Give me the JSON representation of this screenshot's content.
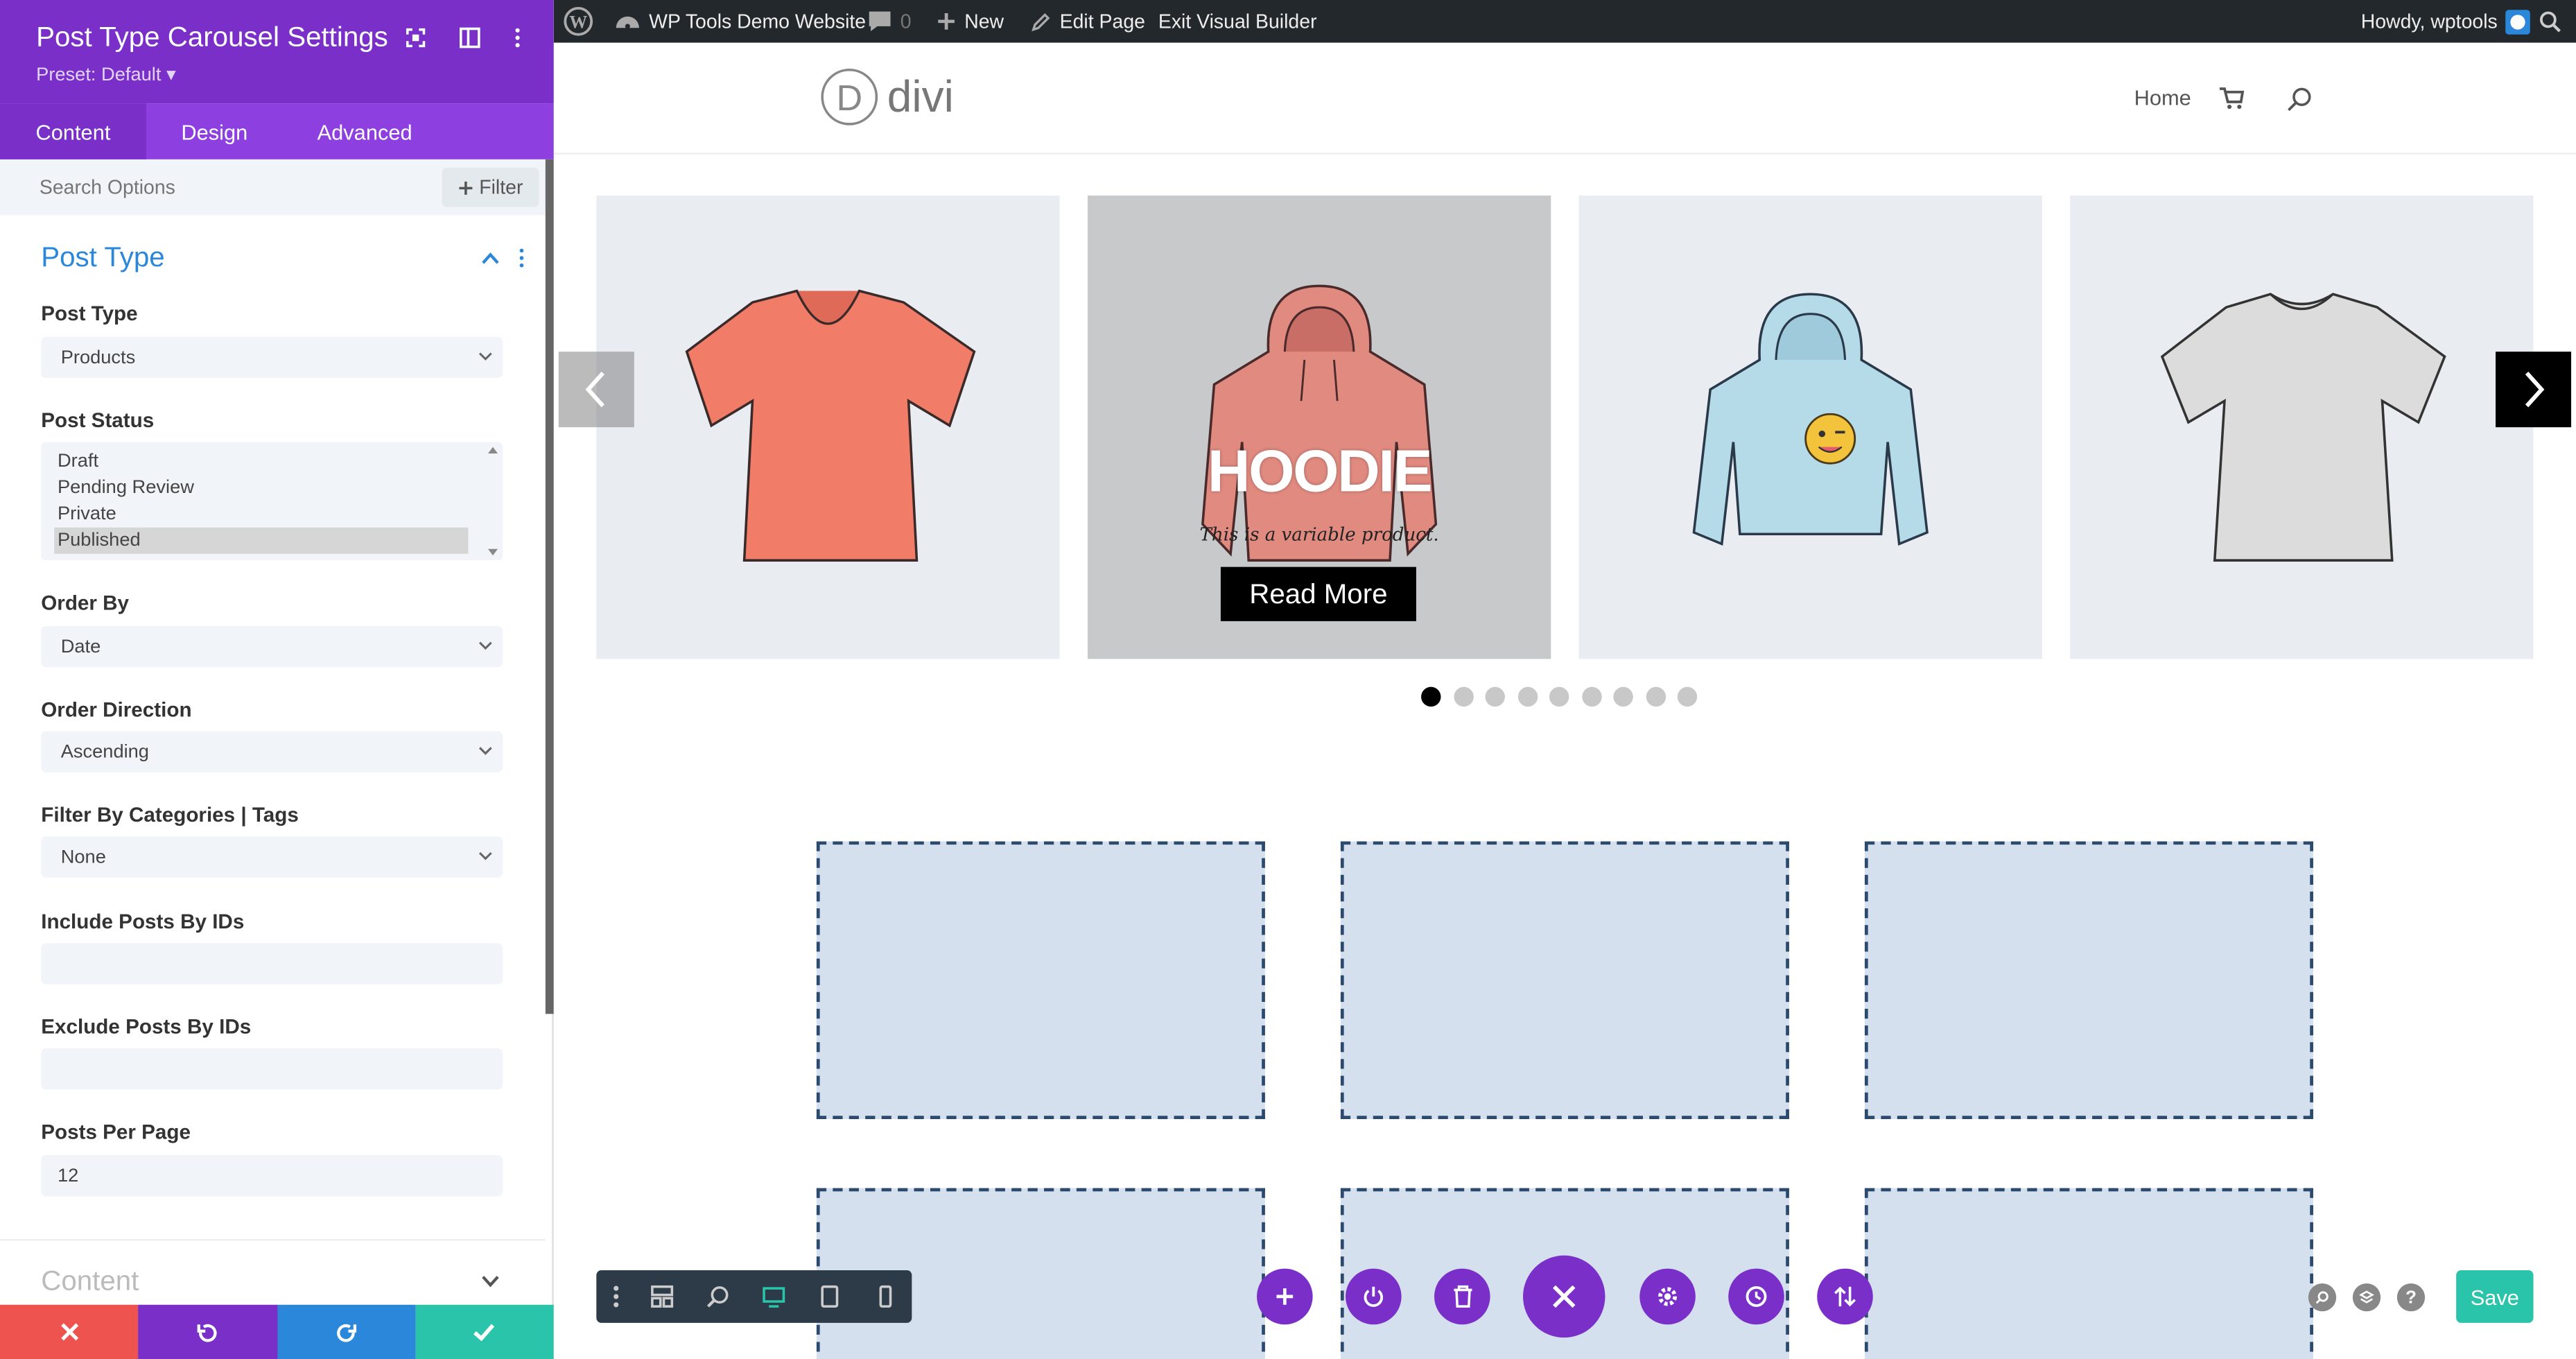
{
  "admin_bar": {
    "site_name": "WP Tools Demo Website",
    "comments_count": "0",
    "new_label": "New",
    "edit_page_label": "Edit Page",
    "exit_builder_label": "Exit Visual Builder",
    "greeting": "Howdy, wptools"
  },
  "panel": {
    "title": "Post Type Carousel Settings",
    "preset": "Preset: Default ▾",
    "tabs": [
      "Content",
      "Design",
      "Advanced"
    ],
    "active_tab": "Content",
    "search_placeholder": "Search Options",
    "filter_label": "Filter",
    "section_title": "Post Type",
    "fields": {
      "post_type": {
        "label": "Post Type",
        "value": "Products"
      },
      "post_status": {
        "label": "Post Status",
        "options": [
          "Draft",
          "Pending Review",
          "Private",
          "Published"
        ],
        "selected": "Published"
      },
      "order_by": {
        "label": "Order By",
        "value": "Date"
      },
      "order_direction": {
        "label": "Order Direction",
        "value": "Ascending"
      },
      "filter_by": {
        "label": "Filter By Categories | Tags",
        "value": "None"
      },
      "include_ids": {
        "label": "Include Posts By IDs",
        "value": ""
      },
      "exclude_ids": {
        "label": "Exclude Posts By IDs",
        "value": ""
      },
      "posts_per_page": {
        "label": "Posts Per Page",
        "value": "12"
      }
    },
    "collapsed_section": "Content",
    "colors": {
      "header": "#7a2fc9",
      "tabs": "#8e3fe0",
      "cancel": "#ef5350",
      "undo": "#7a2fc9",
      "redo": "#2b87da",
      "confirm": "#29c4a9"
    }
  },
  "site": {
    "logo_text": "divi",
    "nav": {
      "home": "Home"
    },
    "carousel": {
      "hover_title": "HOODIE",
      "hover_description": "This is a variable product.",
      "read_more": "Read More",
      "dot_count": 9,
      "active_dot": 0
    }
  },
  "toolbar": {
    "save_label": "Save"
  }
}
